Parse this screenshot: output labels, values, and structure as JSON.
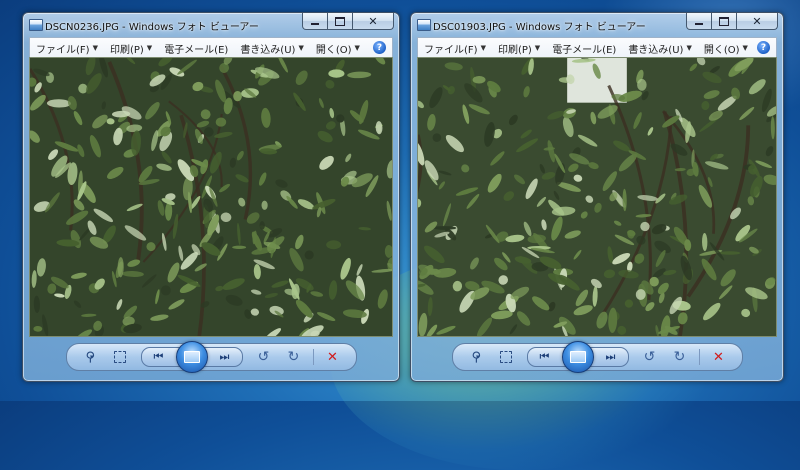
{
  "windows": [
    {
      "title": "DSCN0236.JPG - Windows フォト ビューアー",
      "menu": [
        "ファイル(F)",
        "印刷(P)",
        "電子メール(E)",
        "書き込み(U)",
        "開く(O)"
      ],
      "help": "?"
    },
    {
      "title": "DSC01903.JPG - Windows フォト ビューアー",
      "menu": [
        "ファイル(F)",
        "印刷(P)",
        "電子メール(E)",
        "書き込み(U)",
        "開く(O)"
      ],
      "help": "?"
    }
  ],
  "icons": {
    "minimize": "minimize-icon",
    "maximize": "maximize-icon",
    "close": "close-icon",
    "zoom": "magnifier-icon",
    "fit": "actual-size-icon",
    "previous": "previous-icon",
    "slideshow": "slideshow-icon",
    "next": "next-icon",
    "rotate_ccw": "rotate-counterclockwise-icon",
    "rotate_cw": "rotate-clockwise-icon",
    "delete": "delete-icon"
  },
  "colors": {
    "desktop": "#1f6fb7",
    "delete": "#d11b1b",
    "foliage_dark": "#2c3a24",
    "foliage_mid": "#5d7a3f",
    "foliage_light": "#a8c48a"
  }
}
